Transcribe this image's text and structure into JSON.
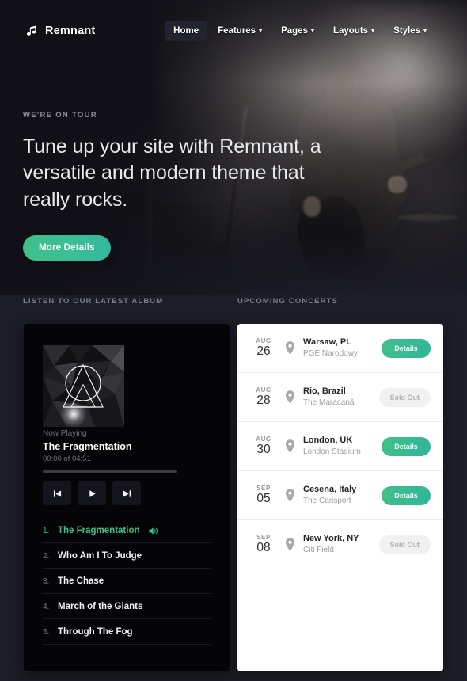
{
  "nav": {
    "brand": "Remnant",
    "brand_icon": "music-note-icon",
    "items": [
      {
        "label": "Home",
        "caret": "",
        "active": true
      },
      {
        "label": "Features",
        "caret": "▾",
        "active": false
      },
      {
        "label": "Pages",
        "caret": "▾",
        "active": false
      },
      {
        "label": "Layouts",
        "caret": "▾",
        "active": false
      },
      {
        "label": "Styles",
        "caret": "▾",
        "active": false
      }
    ]
  },
  "hero": {
    "eyebrow": "WE'RE ON TOUR",
    "title": "Tune up your site with Remnant, a versatile and modern theme that really rocks.",
    "cta": "More Details"
  },
  "sections": {
    "album_label": "LISTEN TO OUR LATEST ALBUM",
    "concerts_label": "UPCOMING CONCERTS"
  },
  "player": {
    "now_playing_label": "Now Playing",
    "current_track": "The Fragmentation",
    "time": "00:00 of 04:51",
    "progress_percent": 0,
    "controls": [
      {
        "name": "previous-track-button",
        "glyph": "⏮"
      },
      {
        "name": "play-button",
        "glyph": "▶"
      },
      {
        "name": "next-track-button",
        "glyph": "⏭"
      }
    ],
    "tracks": [
      {
        "num": "1.",
        "title": "The Fragmentation",
        "playing": true
      },
      {
        "num": "2.",
        "title": "Who Am I To Judge",
        "playing": false
      },
      {
        "num": "3.",
        "title": "The Chase",
        "playing": false
      },
      {
        "num": "4.",
        "title": "March of the Giants",
        "playing": false
      },
      {
        "num": "5.",
        "title": "Through The Fog",
        "playing": false
      }
    ]
  },
  "concerts": [
    {
      "month": "AUG",
      "day": "26",
      "city": "Warsaw, PL",
      "venue": "PGE Narodowy",
      "action": "Details",
      "sold_out": false
    },
    {
      "month": "AUG",
      "day": "28",
      "city": "Rio, Brazil",
      "venue": "The Maracanã",
      "action": "Sold Out",
      "sold_out": true
    },
    {
      "month": "AUG",
      "day": "30",
      "city": "London, UK",
      "venue": "London Stadium",
      "action": "Details",
      "sold_out": false
    },
    {
      "month": "SEP",
      "day": "05",
      "city": "Cesena, Italy",
      "venue": "The Carisport",
      "action": "Details",
      "sold_out": false
    },
    {
      "month": "SEP",
      "day": "08",
      "city": "New York, NY",
      "venue": "Citi Field",
      "action": "Sold Out",
      "sold_out": true
    }
  ],
  "colors": {
    "accent_green": "#3fc08a",
    "page_bg": "#1d1d29",
    "player_bg": "#050507",
    "card_bg": "#ffffff"
  }
}
